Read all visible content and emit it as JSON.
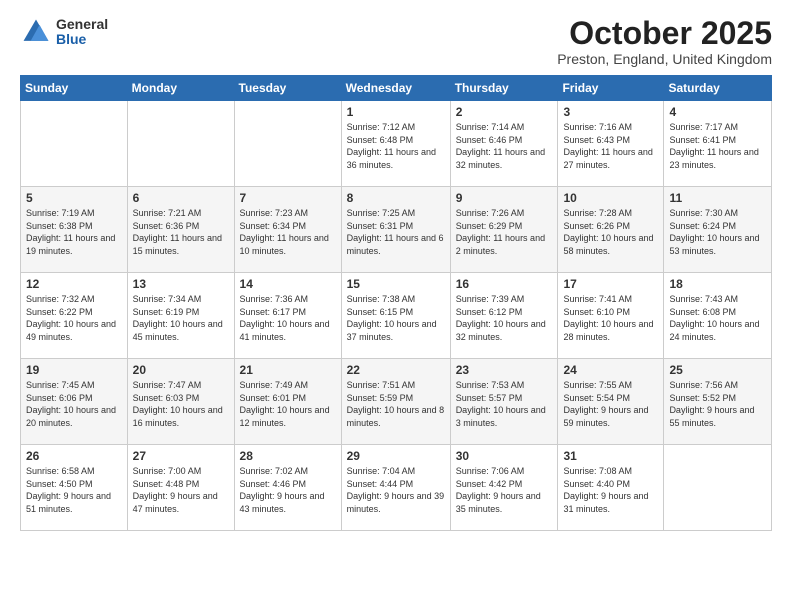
{
  "header": {
    "logo_general": "General",
    "logo_blue": "Blue",
    "month_title": "October 2025",
    "location": "Preston, England, United Kingdom"
  },
  "days_of_week": [
    "Sunday",
    "Monday",
    "Tuesday",
    "Wednesday",
    "Thursday",
    "Friday",
    "Saturday"
  ],
  "weeks": [
    [
      {
        "day": "",
        "sunrise": "",
        "sunset": "",
        "daylight": ""
      },
      {
        "day": "",
        "sunrise": "",
        "sunset": "",
        "daylight": ""
      },
      {
        "day": "",
        "sunrise": "",
        "sunset": "",
        "daylight": ""
      },
      {
        "day": "1",
        "sunrise": "Sunrise: 7:12 AM",
        "sunset": "Sunset: 6:48 PM",
        "daylight": "Daylight: 11 hours and 36 minutes."
      },
      {
        "day": "2",
        "sunrise": "Sunrise: 7:14 AM",
        "sunset": "Sunset: 6:46 PM",
        "daylight": "Daylight: 11 hours and 32 minutes."
      },
      {
        "day": "3",
        "sunrise": "Sunrise: 7:16 AM",
        "sunset": "Sunset: 6:43 PM",
        "daylight": "Daylight: 11 hours and 27 minutes."
      },
      {
        "day": "4",
        "sunrise": "Sunrise: 7:17 AM",
        "sunset": "Sunset: 6:41 PM",
        "daylight": "Daylight: 11 hours and 23 minutes."
      }
    ],
    [
      {
        "day": "5",
        "sunrise": "Sunrise: 7:19 AM",
        "sunset": "Sunset: 6:38 PM",
        "daylight": "Daylight: 11 hours and 19 minutes."
      },
      {
        "day": "6",
        "sunrise": "Sunrise: 7:21 AM",
        "sunset": "Sunset: 6:36 PM",
        "daylight": "Daylight: 11 hours and 15 minutes."
      },
      {
        "day": "7",
        "sunrise": "Sunrise: 7:23 AM",
        "sunset": "Sunset: 6:34 PM",
        "daylight": "Daylight: 11 hours and 10 minutes."
      },
      {
        "day": "8",
        "sunrise": "Sunrise: 7:25 AM",
        "sunset": "Sunset: 6:31 PM",
        "daylight": "Daylight: 11 hours and 6 minutes."
      },
      {
        "day": "9",
        "sunrise": "Sunrise: 7:26 AM",
        "sunset": "Sunset: 6:29 PM",
        "daylight": "Daylight: 11 hours and 2 minutes."
      },
      {
        "day": "10",
        "sunrise": "Sunrise: 7:28 AM",
        "sunset": "Sunset: 6:26 PM",
        "daylight": "Daylight: 10 hours and 58 minutes."
      },
      {
        "day": "11",
        "sunrise": "Sunrise: 7:30 AM",
        "sunset": "Sunset: 6:24 PM",
        "daylight": "Daylight: 10 hours and 53 minutes."
      }
    ],
    [
      {
        "day": "12",
        "sunrise": "Sunrise: 7:32 AM",
        "sunset": "Sunset: 6:22 PM",
        "daylight": "Daylight: 10 hours and 49 minutes."
      },
      {
        "day": "13",
        "sunrise": "Sunrise: 7:34 AM",
        "sunset": "Sunset: 6:19 PM",
        "daylight": "Daylight: 10 hours and 45 minutes."
      },
      {
        "day": "14",
        "sunrise": "Sunrise: 7:36 AM",
        "sunset": "Sunset: 6:17 PM",
        "daylight": "Daylight: 10 hours and 41 minutes."
      },
      {
        "day": "15",
        "sunrise": "Sunrise: 7:38 AM",
        "sunset": "Sunset: 6:15 PM",
        "daylight": "Daylight: 10 hours and 37 minutes."
      },
      {
        "day": "16",
        "sunrise": "Sunrise: 7:39 AM",
        "sunset": "Sunset: 6:12 PM",
        "daylight": "Daylight: 10 hours and 32 minutes."
      },
      {
        "day": "17",
        "sunrise": "Sunrise: 7:41 AM",
        "sunset": "Sunset: 6:10 PM",
        "daylight": "Daylight: 10 hours and 28 minutes."
      },
      {
        "day": "18",
        "sunrise": "Sunrise: 7:43 AM",
        "sunset": "Sunset: 6:08 PM",
        "daylight": "Daylight: 10 hours and 24 minutes."
      }
    ],
    [
      {
        "day": "19",
        "sunrise": "Sunrise: 7:45 AM",
        "sunset": "Sunset: 6:06 PM",
        "daylight": "Daylight: 10 hours and 20 minutes."
      },
      {
        "day": "20",
        "sunrise": "Sunrise: 7:47 AM",
        "sunset": "Sunset: 6:03 PM",
        "daylight": "Daylight: 10 hours and 16 minutes."
      },
      {
        "day": "21",
        "sunrise": "Sunrise: 7:49 AM",
        "sunset": "Sunset: 6:01 PM",
        "daylight": "Daylight: 10 hours and 12 minutes."
      },
      {
        "day": "22",
        "sunrise": "Sunrise: 7:51 AM",
        "sunset": "Sunset: 5:59 PM",
        "daylight": "Daylight: 10 hours and 8 minutes."
      },
      {
        "day": "23",
        "sunrise": "Sunrise: 7:53 AM",
        "sunset": "Sunset: 5:57 PM",
        "daylight": "Daylight: 10 hours and 3 minutes."
      },
      {
        "day": "24",
        "sunrise": "Sunrise: 7:55 AM",
        "sunset": "Sunset: 5:54 PM",
        "daylight": "Daylight: 9 hours and 59 minutes."
      },
      {
        "day": "25",
        "sunrise": "Sunrise: 7:56 AM",
        "sunset": "Sunset: 5:52 PM",
        "daylight": "Daylight: 9 hours and 55 minutes."
      }
    ],
    [
      {
        "day": "26",
        "sunrise": "Sunrise: 6:58 AM",
        "sunset": "Sunset: 4:50 PM",
        "daylight": "Daylight: 9 hours and 51 minutes."
      },
      {
        "day": "27",
        "sunrise": "Sunrise: 7:00 AM",
        "sunset": "Sunset: 4:48 PM",
        "daylight": "Daylight: 9 hours and 47 minutes."
      },
      {
        "day": "28",
        "sunrise": "Sunrise: 7:02 AM",
        "sunset": "Sunset: 4:46 PM",
        "daylight": "Daylight: 9 hours and 43 minutes."
      },
      {
        "day": "29",
        "sunrise": "Sunrise: 7:04 AM",
        "sunset": "Sunset: 4:44 PM",
        "daylight": "Daylight: 9 hours and 39 minutes."
      },
      {
        "day": "30",
        "sunrise": "Sunrise: 7:06 AM",
        "sunset": "Sunset: 4:42 PM",
        "daylight": "Daylight: 9 hours and 35 minutes."
      },
      {
        "day": "31",
        "sunrise": "Sunrise: 7:08 AM",
        "sunset": "Sunset: 4:40 PM",
        "daylight": "Daylight: 9 hours and 31 minutes."
      },
      {
        "day": "",
        "sunrise": "",
        "sunset": "",
        "daylight": ""
      }
    ]
  ]
}
